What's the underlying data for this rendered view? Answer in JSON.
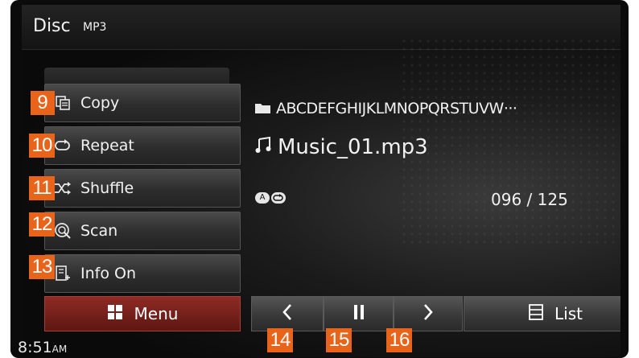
{
  "titlebar": {
    "source": "Disc",
    "format": "MP3"
  },
  "menu": {
    "items": [
      {
        "callout": "9",
        "icon": "copy-icon",
        "label": "Copy"
      },
      {
        "callout": "10",
        "icon": "repeat-icon",
        "label": "Repeat"
      },
      {
        "callout": "11",
        "icon": "shuffle-icon",
        "label": "Shuffle"
      },
      {
        "callout": "12",
        "icon": "scan-icon",
        "label": "Scan"
      },
      {
        "callout": "13",
        "icon": "info-icon",
        "label": "Info On"
      }
    ]
  },
  "now_playing": {
    "folder": "ABCDEFGHIJKLMNOPQRSTUVW···",
    "track": "Music_01.mp3",
    "badge_left": "A",
    "counter": "096 / 125"
  },
  "bottombar": {
    "menu_label": "Menu",
    "list_label": "List",
    "controls": [
      {
        "callout": "14",
        "icon": "chevron-left-icon"
      },
      {
        "callout": "15",
        "icon": "pause-icon"
      },
      {
        "callout": "16",
        "icon": "chevron-right-icon"
      }
    ]
  },
  "status": {
    "time": "8:51",
    "ampm": "AM"
  },
  "colors": {
    "accent": "#e8641b",
    "menu_button": "#7a221d",
    "background": "#0b0b0b"
  }
}
